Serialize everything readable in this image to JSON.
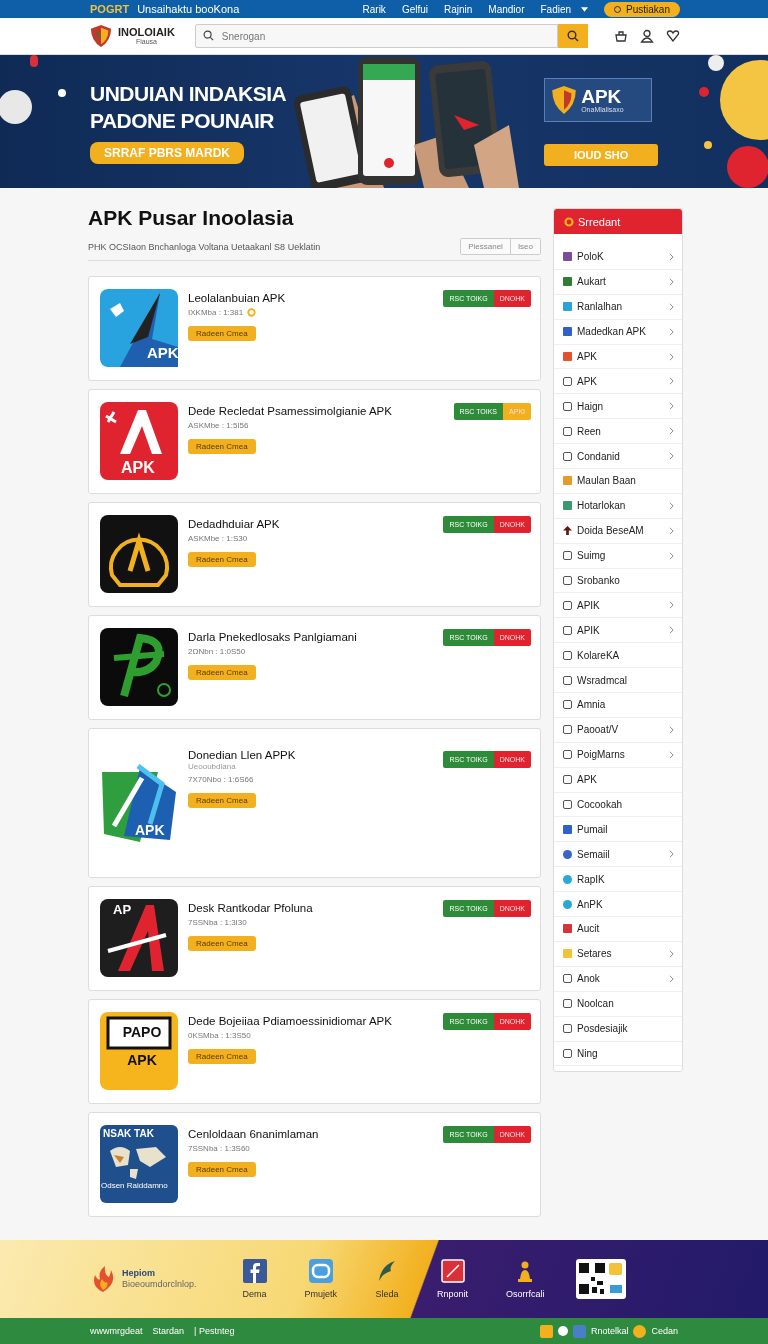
{
  "top_bar": {
    "logo": "POGRT",
    "tagline": "Unsaihaktu booKona",
    "nav": [
      "Rarik",
      "Gelfui",
      "Rajnin",
      "Mandior",
      "Fadien"
    ],
    "button": "Pustiakan"
  },
  "header": {
    "brand": "INOLOIAIK",
    "brand_sub": "Fiausa",
    "search": {
      "placeholder": "Snerogan"
    }
  },
  "banner": {
    "headline": [
      "UNDUIAN INDAKSIA",
      "PADONE POUNAIR"
    ],
    "cta": "SRRAF PBRS MARDK",
    "card_title": "APK",
    "card_sub": "OnaMlalisaxo",
    "card_button": "IOUD SHO"
  },
  "page": {
    "title": "APK Pusar Inoolasia",
    "subtitle": "PHK OCSIaon Bnchanloga Voltana Uetaakanl S8 Ueklatin",
    "segments": [
      {
        "label": "Piessanel",
        "selected": false
      },
      {
        "label": "Iseo",
        "selected": false
      }
    ]
  },
  "apps": [
    {
      "title": "Leolalanbuian APK",
      "meta": "IXKMba : 1:381",
      "verified": true,
      "button": "Radeen Cmea",
      "icon": {
        "kind": "bolt",
        "texts": [
          "APK"
        ]
      },
      "tags": [
        {
          "label": "RSC TOIKG",
          "color": "#2e8b3a"
        },
        {
          "label": "DNOHK",
          "color": "#e0242f"
        }
      ]
    },
    {
      "title": "Dede Recledat Psamessimolgianie APK",
      "meta": "ASKMbe : 1:5I56",
      "verified": false,
      "button": "Radeen Cmea",
      "icon": {
        "kind": "letter-a",
        "texts": [
          "APK"
        ]
      },
      "tags": [
        {
          "label": "RSC TOIKS",
          "color": "#2e8b3a"
        },
        {
          "label": "APKI",
          "color": "#f2b01e"
        }
      ]
    },
    {
      "title": "Dedadhduiar APK",
      "meta": "ASKMbe : 1:S30",
      "verified": false,
      "button": "Radeen Cmea",
      "icon": {
        "kind": "gauge"
      },
      "tags": [
        {
          "label": "RSC TOIKG",
          "color": "#2e8b3a"
        },
        {
          "label": "DNOHK",
          "color": "#e0242f"
        }
      ]
    },
    {
      "title": "Darla Pnekedlosaks Panlgiamani",
      "meta": "2ΩNbn : 1:0S50",
      "verified": false,
      "button": "Radeen Cmea",
      "icon": {
        "kind": "p-mark"
      },
      "tags": [
        {
          "label": "RSC TOIKG",
          "color": "#2e8b3a"
        },
        {
          "label": "DNOHK",
          "color": "#e0242f"
        }
      ]
    },
    {
      "title": "Donedian Llen APPK",
      "subline": "Ueooubdiana",
      "meta": "7X70Nbo : 1:6S66",
      "verified": false,
      "button": "Radeen Cmea",
      "icon": {
        "kind": "split",
        "texts": [
          "APK"
        ]
      },
      "tags": [
        {
          "label": "RSC TOIKG",
          "color": "#2e8b3a"
        },
        {
          "label": "DNOHK",
          "color": "#e0242f"
        }
      ]
    },
    {
      "title": "Desk Rantkodar Pfoluna",
      "meta": "7SSNba : 1:3I30",
      "verified": false,
      "button": "Radeen Cmea",
      "icon": {
        "kind": "slash-a",
        "texts": [
          "AP"
        ]
      },
      "tags": [
        {
          "label": "RSC TOIKG",
          "color": "#2e8b3a"
        },
        {
          "label": "DNOHK",
          "color": "#e0242f"
        }
      ]
    },
    {
      "title": "Dede Bojeiiaa Pdiamoessinidiomar APK",
      "meta": "0KSMba : 1:3S50",
      "verified": false,
      "button": "Radeen Cmea",
      "icon": {
        "kind": "sign",
        "texts": [
          "PAPO",
          "APK"
        ]
      },
      "tags": [
        {
          "label": "RSC TOIKG",
          "color": "#2e8b3a"
        },
        {
          "label": "DNOHK",
          "color": "#e0242f"
        }
      ]
    },
    {
      "title": "Cenloldaan 6nanimlaman",
      "meta": "7SSNba : 1:3S60",
      "verified": false,
      "button": "Radeen Cmea",
      "icon": {
        "kind": "map",
        "texts": [
          "NSAK TAK",
          "Odsen Raiddamno"
        ]
      },
      "tags": [
        {
          "label": "RSC TOIKG",
          "color": "#2e8b3a"
        },
        {
          "label": "DNOHK",
          "color": "#e0242f"
        }
      ]
    }
  ],
  "sidebar": {
    "title": "Srredant",
    "items": [
      {
        "label": "PoloK",
        "kind": "solid",
        "color": "#7a4c9c",
        "chevron": true
      },
      {
        "label": "Aukart",
        "kind": "solid",
        "color": "#2f7d32",
        "chevron": true
      },
      {
        "label": "Ranlalhan",
        "kind": "solid",
        "color": "#2aa3d8",
        "chevron": true
      },
      {
        "label": "Madedkan APK",
        "kind": "solid",
        "color": "#2f62c4",
        "chevron": true
      },
      {
        "label": "APK",
        "kind": "solid",
        "color": "#e5512d",
        "chevron": true
      },
      {
        "label": "APK",
        "kind": "outline",
        "chevron": true
      },
      {
        "label": "Haign",
        "kind": "outline",
        "chevron": true
      },
      {
        "label": "Reen",
        "kind": "outline",
        "chevron": true
      },
      {
        "label": "Condanid",
        "kind": "outline",
        "chevron": true
      },
      {
        "label": "Maulan Baan",
        "kind": "solid",
        "color": "#e59b2a",
        "chevron": false
      },
      {
        "label": "Hotarlokan",
        "kind": "solid",
        "color": "#3a9a6e",
        "chevron": true
      },
      {
        "label": "Doida BeseAM",
        "kind": "arrow",
        "chevron": true
      },
      {
        "label": "Suimg",
        "kind": "outline",
        "chevron": true
      },
      {
        "label": "Srobanko",
        "kind": "outline",
        "chevron": false
      },
      {
        "label": "APIK",
        "kind": "outline",
        "chevron": true
      },
      {
        "label": "APIK",
        "kind": "outline",
        "chevron": true
      },
      {
        "label": "KolareKA",
        "kind": "outline",
        "chevron": false
      },
      {
        "label": "Wsradmcal",
        "kind": "outline",
        "chevron": false
      },
      {
        "label": "Amnia",
        "kind": "outline",
        "chevron": false
      },
      {
        "label": "Paooat/V",
        "kind": "outline",
        "chevron": true
      },
      {
        "label": "PoigMarns",
        "kind": "outline",
        "chevron": true
      },
      {
        "label": "APK",
        "kind": "outline",
        "chevron": false
      },
      {
        "label": "Cocookah",
        "kind": "outline",
        "chevron": false
      },
      {
        "label": "Pumail",
        "kind": "solid",
        "color": "#2f62c4",
        "chevron": false
      },
      {
        "label": "Semaiil",
        "kind": "round",
        "color": "#3566c8",
        "chevron": true
      },
      {
        "label": "RapIK",
        "kind": "round",
        "color": "#2aa9d8",
        "chevron": false
      },
      {
        "label": "AnPK",
        "kind": "round",
        "color": "#28a8d6",
        "chevron": false
      },
      {
        "label": "Aucit",
        "kind": "solid",
        "color": "#d9303a",
        "chevron": false
      },
      {
        "label": "Setares",
        "kind": "solid",
        "color": "#f2c23a",
        "chevron": true
      },
      {
        "label": "Anok",
        "kind": "outline",
        "chevron": true
      },
      {
        "label": "Noolcan",
        "kind": "outline",
        "chevron": false
      },
      {
        "label": "Posdesiajik",
        "kind": "outline",
        "chevron": false
      },
      {
        "label": "Ning",
        "kind": "outline",
        "chevron": false
      }
    ]
  },
  "footer": {
    "brand": "Hepiom",
    "brand_sub": "Bioeoumdorclnlop.",
    "links": [
      {
        "label": "Dema",
        "kind": "facebook"
      },
      {
        "label": "Pmujetk",
        "kind": "s-badge"
      },
      {
        "label": "Sleda",
        "kind": "leaf"
      },
      {
        "label": "Rnponit",
        "kind": "red-tile"
      },
      {
        "label": "Osorrfcali",
        "kind": "figure"
      }
    ]
  },
  "bottom_bar": {
    "left": [
      "wwwmrgdeat",
      "Stardan",
      "| Pestnteg"
    ],
    "right_label": "Rnotelkal",
    "right_link": "Cedan"
  }
}
